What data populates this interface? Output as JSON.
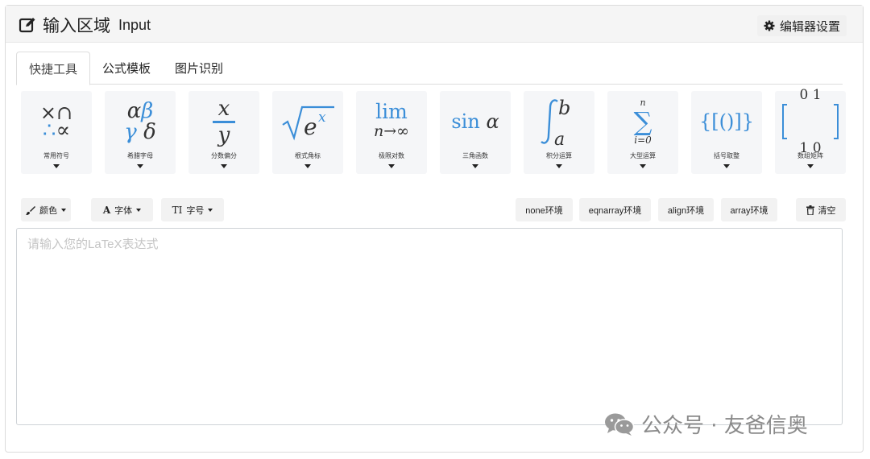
{
  "header": {
    "title": "输入区域",
    "subtitle": "Input",
    "settings_label": "编辑器设置"
  },
  "tabs": [
    {
      "label": "快捷工具",
      "active": true
    },
    {
      "label": "公式模板",
      "active": false
    },
    {
      "label": "图片识别",
      "active": false
    }
  ],
  "tools": [
    {
      "label": "常用符号",
      "glyph_top": "×∩",
      "glyph_bottom": "∴∝"
    },
    {
      "label": "希腊字母",
      "glyph_top": "αβ",
      "glyph_bottom": "γδ"
    },
    {
      "label": "分数偏分",
      "glyph_top": "x",
      "glyph_bottom": "y"
    },
    {
      "label": "根式角标",
      "glyph_top": "e",
      "glyph_bottom": "x"
    },
    {
      "label": "极限对数",
      "glyph_top": "lim",
      "glyph_bottom": "n→∞"
    },
    {
      "label": "三角函数",
      "glyph_top": "sin",
      "glyph_bottom": "α"
    },
    {
      "label": "积分运算",
      "glyph_top": "b",
      "glyph_bottom": "a"
    },
    {
      "label": "大型运算",
      "glyph_top": "n",
      "glyph_bottom": "i=0"
    },
    {
      "label": "括号取整",
      "glyph_top": "{[()]}",
      "glyph_bottom": ""
    },
    {
      "label": "数组矩阵",
      "glyph_top": "0 1",
      "glyph_bottom": "1 0"
    }
  ],
  "format_bar": {
    "color_label": "颜色",
    "font_icon": "A",
    "font_label": "字体",
    "size_icon": "TI",
    "size_label": "字号",
    "env_buttons": [
      "none环境",
      "eqnarray环境",
      "align环境",
      "array环境"
    ],
    "clear_label": "清空"
  },
  "editor": {
    "placeholder": "请输入您的LaTeX表达式",
    "value": ""
  },
  "watermark": {
    "text": "公众号 · 友爸信奥"
  },
  "colors": {
    "accent_blue": "#3b8ed8",
    "header_bg": "#f5f5f5",
    "tool_bg": "#f5f6f8"
  },
  "icons": {
    "header": "edit-icon",
    "settings": "gear-icon",
    "color": "brush-icon",
    "clear": "trash-icon",
    "watermark": "wechat-icon"
  }
}
